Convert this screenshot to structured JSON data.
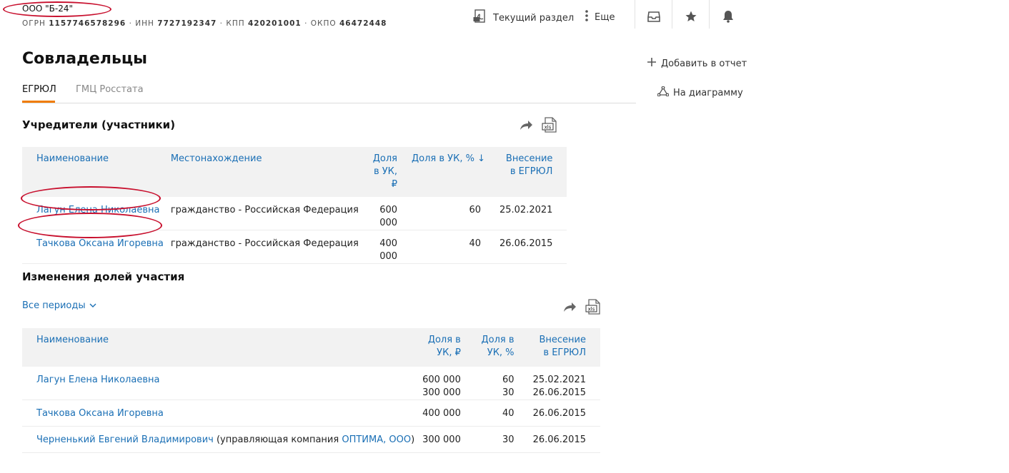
{
  "company": {
    "name": "ООО \"Б-24\"",
    "ogrn_label": "ОГРН",
    "ogrn": "1157746578296",
    "inn_label": "ИНН",
    "inn": "7727192347",
    "kpp_label": "КПП",
    "kpp": "420201001",
    "okpo_label": "ОКПО",
    "okpo": "46472448",
    "sep": "·"
  },
  "header": {
    "current_section": "Текущий раздел",
    "more": "Еще"
  },
  "page": {
    "title": "Совладельцы",
    "tabs": [
      {
        "label": "ЕГРЮЛ",
        "active": true
      },
      {
        "label": "ГМЦ Росстата",
        "active": false
      }
    ]
  },
  "sidebar": {
    "add_to_report": "Добавить в отчет",
    "to_diagram": "На диаграмму"
  },
  "founders": {
    "title": "Учредители (участники)",
    "columns": {
      "name": "Наименование",
      "location": "Местонахождение",
      "share_rub": "Доля в УК, ₽",
      "share_pct": "Доля в УК, % ↓",
      "entry_1": "Внесение",
      "entry_2": "в ЕГРЮЛ"
    },
    "rows": [
      {
        "name": "Лагун Елена Николаевна",
        "location": "гражданство - Российская Федерация",
        "share_rub": "600 000",
        "share_pct": "60",
        "date": "25.02.2021"
      },
      {
        "name": "Тачкова Оксана Игоревна",
        "location": "гражданство - Российская Федерация",
        "share_rub": "400 000",
        "share_pct": "40",
        "date": "26.06.2015"
      }
    ]
  },
  "changes": {
    "title": "Изменения долей участия",
    "period_filter": "Все периоды",
    "columns": {
      "name": "Наименование",
      "share_rub": "Доля в УК, ₽",
      "share_pct": "Доля в УК, %",
      "entry_1": "Внесение",
      "entry_2": "в ЕГРЮЛ"
    },
    "rows": [
      {
        "name": "Лагун Елена Николаевна",
        "share_rub_1": "600 000",
        "share_rub_2": "300 000",
        "share_pct_1": "60",
        "share_pct_2": "30",
        "date_1": "25.02.2021",
        "date_2": "26.06.2015"
      },
      {
        "name": "Тачкова Оксана Игоревна",
        "share_rub": "400 000",
        "share_pct": "40",
        "date": "26.06.2015"
      },
      {
        "name": "Черненький Евгений Владимирович",
        "note_prefix": "(управляющая компания",
        "company_link": "ОПТИМА, ООО",
        "note_suffix": ")",
        "share_rub": "300 000",
        "share_pct": "30",
        "date": "26.06.2015"
      }
    ]
  },
  "icons": {
    "pdf": "pdf-icon",
    "more": "more-dots-icon",
    "inbox": "inbox-icon",
    "star": "star-icon",
    "bell": "bell-icon",
    "plus": "plus-icon",
    "diagram": "diagram-icon",
    "share": "share-icon",
    "xls": "xls-icon",
    "chevron": "chevron-down-icon"
  },
  "colors": {
    "link": "#1a6fb5",
    "accent": "#f07c00",
    "annotation": "#c8102e",
    "header_bg": "#f2f2f2"
  }
}
